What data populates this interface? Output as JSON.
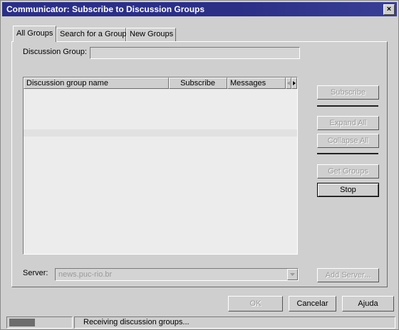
{
  "window": {
    "title": "Communicator: Subscribe to Discussion Groups",
    "close_glyph": "×"
  },
  "tabs": [
    {
      "label": "All Groups",
      "active": true
    },
    {
      "label": "Search for a Group",
      "active": false
    },
    {
      "label": "New Groups",
      "active": false
    }
  ],
  "discussion_group": {
    "label": "Discussion Group:",
    "value": ""
  },
  "list": {
    "columns": [
      "Discussion group name",
      "Subscribe",
      "Messages"
    ],
    "rows": []
  },
  "buttons": {
    "subscribe": "Subscribe",
    "expand_all": "Expand All",
    "collapse_all": "Collapse All",
    "get_groups": "Get Groups",
    "stop": "Stop",
    "add_server": "Add Server...",
    "ok": "OK",
    "cancel": "Cancelar",
    "help": "Ajuda"
  },
  "server": {
    "label": "Server:",
    "value": "news.puc-rio.br"
  },
  "status": {
    "text": "Receiving discussion groups..."
  }
}
